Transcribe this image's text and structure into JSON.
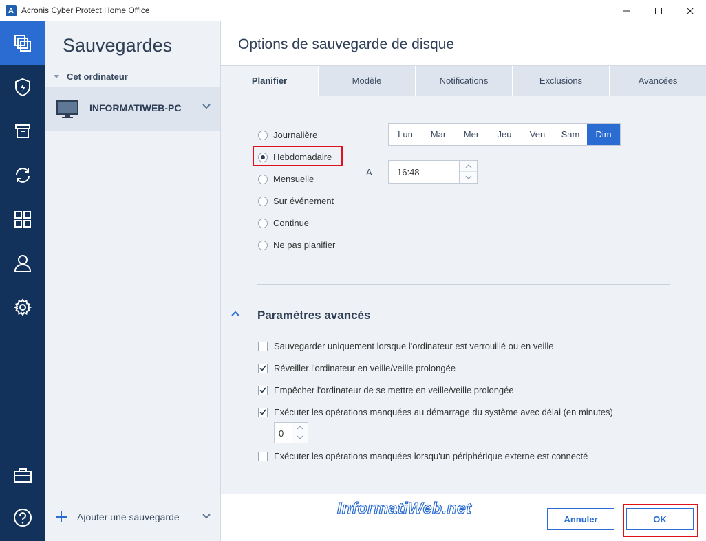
{
  "window": {
    "title": "Acronis Cyber Protect Home Office",
    "app_icon_letter": "A"
  },
  "rail": {
    "items": [
      {
        "icon": "backups-icon",
        "active": true
      },
      {
        "icon": "shield-icon"
      },
      {
        "icon": "archive-icon"
      },
      {
        "icon": "sync-icon"
      },
      {
        "icon": "dashboard-icon"
      },
      {
        "icon": "account-icon"
      },
      {
        "icon": "gear-icon"
      },
      {
        "icon": "briefcase-icon"
      },
      {
        "icon": "help-icon"
      }
    ]
  },
  "sidebar": {
    "title": "Sauvegardes",
    "group_label": "Cet ordinateur",
    "item_label": "INFORMATIWEB-PC",
    "add_label": "Ajouter une sauvegarde"
  },
  "main": {
    "title": "Options de sauvegarde de disque",
    "tabs": [
      {
        "label": "Planifier",
        "active": true
      },
      {
        "label": "Modèle"
      },
      {
        "label": "Notifications"
      },
      {
        "label": "Exclusions"
      },
      {
        "label": "Avancées"
      }
    ]
  },
  "schedule": {
    "options": [
      {
        "label": "Journalière"
      },
      {
        "label": "Hebdomadaire",
        "checked": true
      },
      {
        "label": "Mensuelle"
      },
      {
        "label": "Sur événement"
      },
      {
        "label": "Continue"
      },
      {
        "label": "Ne pas planifier"
      }
    ],
    "days": [
      "Lun",
      "Mar",
      "Mer",
      "Jeu",
      "Ven",
      "Sam",
      "Dim"
    ],
    "selected_day": "Dim",
    "at_label": "A",
    "time": "16:48"
  },
  "advanced": {
    "title": "Paramètres avancés",
    "options": [
      {
        "label": "Sauvegarder uniquement lorsque l'ordinateur est verrouillé ou en veille",
        "checked": false
      },
      {
        "label": "Réveiller l'ordinateur en veille/veille prolongée",
        "checked": true
      },
      {
        "label": "Empêcher l'ordinateur de se mettre en veille/veille prolongée",
        "checked": true
      },
      {
        "label": "Exécuter les opérations manquées au démarrage du système avec délai (en minutes)",
        "checked": true
      },
      {
        "label": "Exécuter les opérations manquées lorsqu'un périphérique externe est connecté",
        "checked": false
      }
    ],
    "delay_value": "0"
  },
  "buttons": {
    "cancel": "Annuler",
    "ok": "OK"
  },
  "watermark": "InformatiWeb.net",
  "colors": {
    "rail": "#12325c",
    "accent": "#2a6cd2",
    "highlight": "#e0111b"
  }
}
